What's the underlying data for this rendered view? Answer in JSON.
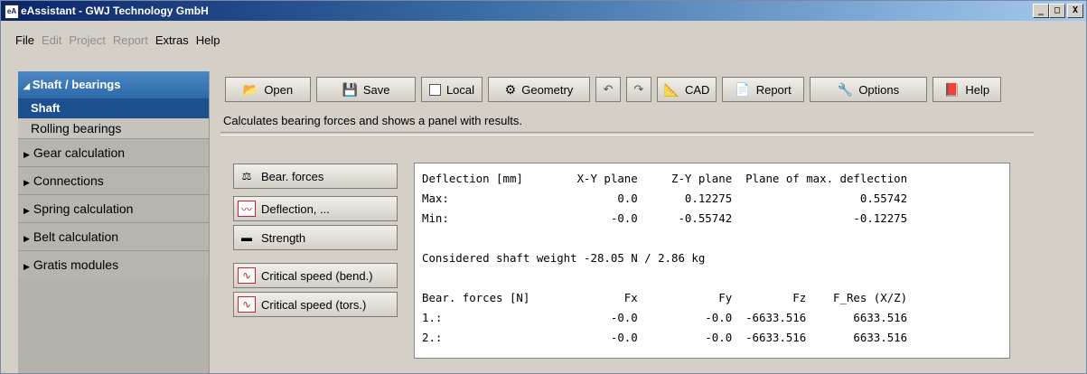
{
  "window": {
    "title": "eAssistant - GWJ Technology GmbH",
    "app_icon_text": "eA",
    "controls": {
      "minimize": "_",
      "maximize": "□",
      "close": "X"
    }
  },
  "menu": {
    "file": "File",
    "edit": "Edit",
    "project": "Project",
    "report": "Report",
    "extras": "Extras",
    "help": "Help"
  },
  "sidebar": {
    "header": "Shaft / bearings",
    "selected": "Shaft",
    "sub": "Rolling bearings",
    "groups": [
      "Gear calculation",
      "Connections",
      "Spring calculation",
      "Belt calculation",
      "Gratis modules"
    ]
  },
  "toolbar": {
    "open": "Open",
    "save": "Save",
    "local": "Local",
    "geometry": "Geometry",
    "undo_icon": "undo-icon",
    "redo_icon": "redo-icon",
    "cad": "CAD",
    "report": "Report",
    "options": "Options",
    "help": "Help"
  },
  "description": "Calculates bearing forces and shows a panel with results.",
  "actions": {
    "bear_forces": "Bear. forces",
    "deflection": "Deflection, ...",
    "strength": "Strength",
    "critical_bend": "Critical speed (bend.)",
    "critical_tors": "Critical speed (tors.)"
  },
  "results": {
    "lines": [
      "Deflection [mm]        X-Y plane     Z-Y plane  Plane of max. deflection",
      "Max:                         0.0       0.12275                   0.55742",
      "Min:                        -0.0      -0.55742                  -0.12275",
      "",
      "Considered shaft weight -28.05 N / 2.86 kg",
      "",
      "Bear. forces [N]              Fx            Fy         Fz    F_Res (X/Z)",
      "1.:                         -0.0          -0.0  -6633.516       6633.516",
      "2.:                         -0.0          -0.0  -6633.516       6633.516"
    ]
  },
  "colors": {
    "sidebar_header": "#2f6aa8",
    "sidebar_selected": "#1c4f8e",
    "titlebar": "#0a246a"
  }
}
